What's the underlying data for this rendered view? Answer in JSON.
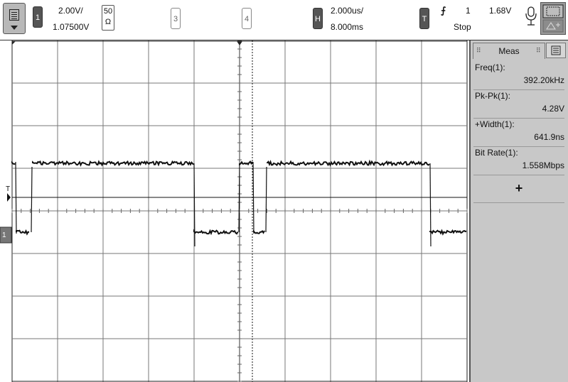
{
  "toolbar": {
    "channel1": {
      "number": "1",
      "scale": "2.00V/",
      "offset": "1.07500V"
    },
    "impedance": {
      "value": "50",
      "unit": "Ω"
    },
    "channel3": {
      "number": "3"
    },
    "channel4": {
      "number": "4"
    },
    "horizontal": {
      "label": "H",
      "scale": "2.000us/",
      "delay": "8.000ms"
    },
    "trigger": {
      "label": "T",
      "edge_symbol": "⨍",
      "source": "1",
      "level": "1.68V",
      "status": "Stop"
    },
    "icons": [
      "menu-icon",
      "microphone-icon",
      "zoom-box-icon",
      "cursor-icon"
    ]
  },
  "screen": {
    "trigger_marker_label": "T",
    "ground_marker_label": "1"
  },
  "meas": {
    "title": "Meas",
    "items": [
      {
        "label": "Freq(1):",
        "value": "392.20kHz"
      },
      {
        "label": "Pk-Pk(1):",
        "value": "4.28V"
      },
      {
        "label": "+Width(1):",
        "value": "641.9ns"
      },
      {
        "label": "Bit Rate(1):",
        "value": "1.558Mbps"
      }
    ],
    "add_symbol": "+"
  },
  "colors": {
    "toolbar_button": "#b8b8b8",
    "channel_active": "#555555",
    "panel": "#c8c8c8",
    "trace": "#111111",
    "grid": "#777777"
  }
}
